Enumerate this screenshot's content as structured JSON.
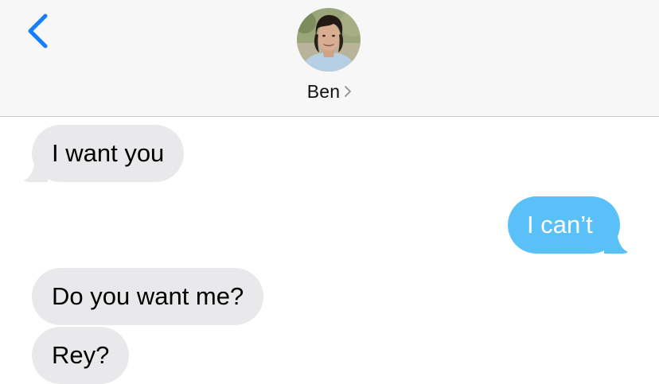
{
  "header": {
    "contact_name": "Ben",
    "icons": {
      "back": "chevron-left-icon",
      "details": "chevron-right-icon"
    },
    "colors": {
      "accent": "#157efb",
      "header_bg": "#f7f7f7",
      "incoming_bubble": "#e9e9eb",
      "outgoing_bubble": "#5ac1f8"
    }
  },
  "messages": [
    {
      "direction": "incoming",
      "text": "I want you"
    },
    {
      "direction": "outgoing",
      "text": "I can’t"
    },
    {
      "direction": "incoming",
      "text": "Do you want me?"
    },
    {
      "direction": "incoming",
      "text": "Rey?"
    }
  ]
}
